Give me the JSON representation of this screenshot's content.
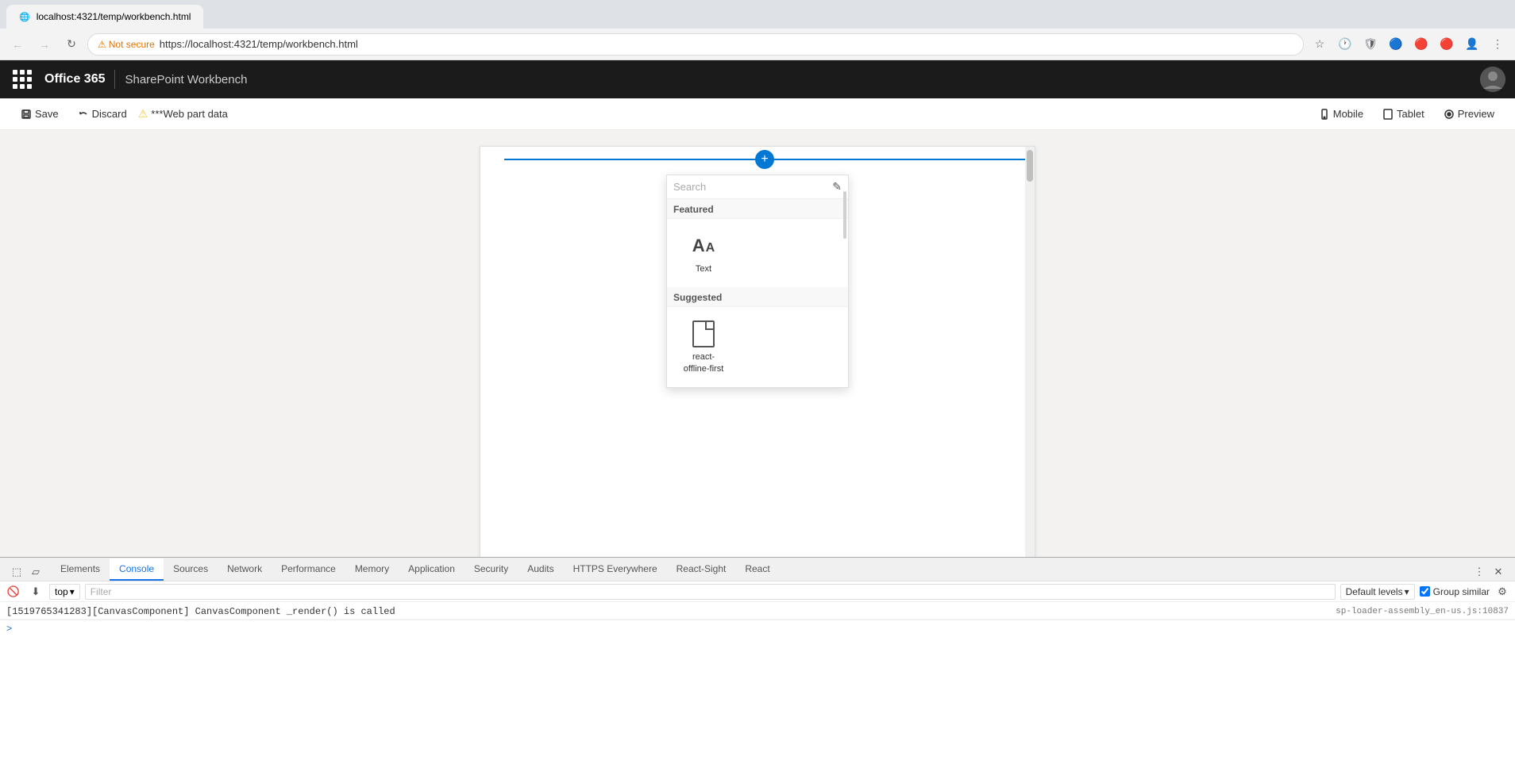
{
  "browser": {
    "tab_label": "localhost:4321/temp/workbench.html",
    "url_insecure": "Not secure",
    "url": "https://localhost:4321/temp/workbench.html"
  },
  "app_bar": {
    "waffle_label": "App launcher",
    "title": "Office 365",
    "subtitle": "SharePoint Workbench",
    "avatar_label": "User avatar"
  },
  "workbench_toolbar": {
    "save_label": "Save",
    "discard_label": "Discard",
    "web_part_data_label": "***Web part data",
    "mobile_label": "Mobile",
    "tablet_label": "Tablet",
    "preview_label": "Preview"
  },
  "webpart_picker": {
    "search_placeholder": "Search",
    "featured_label": "Featured",
    "suggested_label": "Suggested",
    "text_item": {
      "label": "Text",
      "icon": "text-icon"
    },
    "react_offline_item": {
      "label": "react-offline-first",
      "icon": "file-icon"
    }
  },
  "devtools": {
    "tabs": [
      {
        "label": "Elements",
        "active": false
      },
      {
        "label": "Console",
        "active": true
      },
      {
        "label": "Sources",
        "active": false
      },
      {
        "label": "Network",
        "active": false
      },
      {
        "label": "Performance",
        "active": false
      },
      {
        "label": "Memory",
        "active": false
      },
      {
        "label": "Application",
        "active": false
      },
      {
        "label": "Security",
        "active": false
      },
      {
        "label": "Audits",
        "active": false
      },
      {
        "label": "HTTPS Everywhere",
        "active": false
      },
      {
        "label": "React-Sight",
        "active": false
      },
      {
        "label": "React",
        "active": false
      }
    ],
    "toolbar": {
      "level_select": "top",
      "filter_placeholder": "Filter",
      "default_levels": "Default levels",
      "group_similar_label": "Group similar",
      "group_similar_checked": true
    },
    "console": {
      "log_message": "[1519765341283][CanvasComponent] CanvasComponent _render() is called",
      "log_source": "sp-loader-assembly_en-us.js:10837"
    }
  }
}
